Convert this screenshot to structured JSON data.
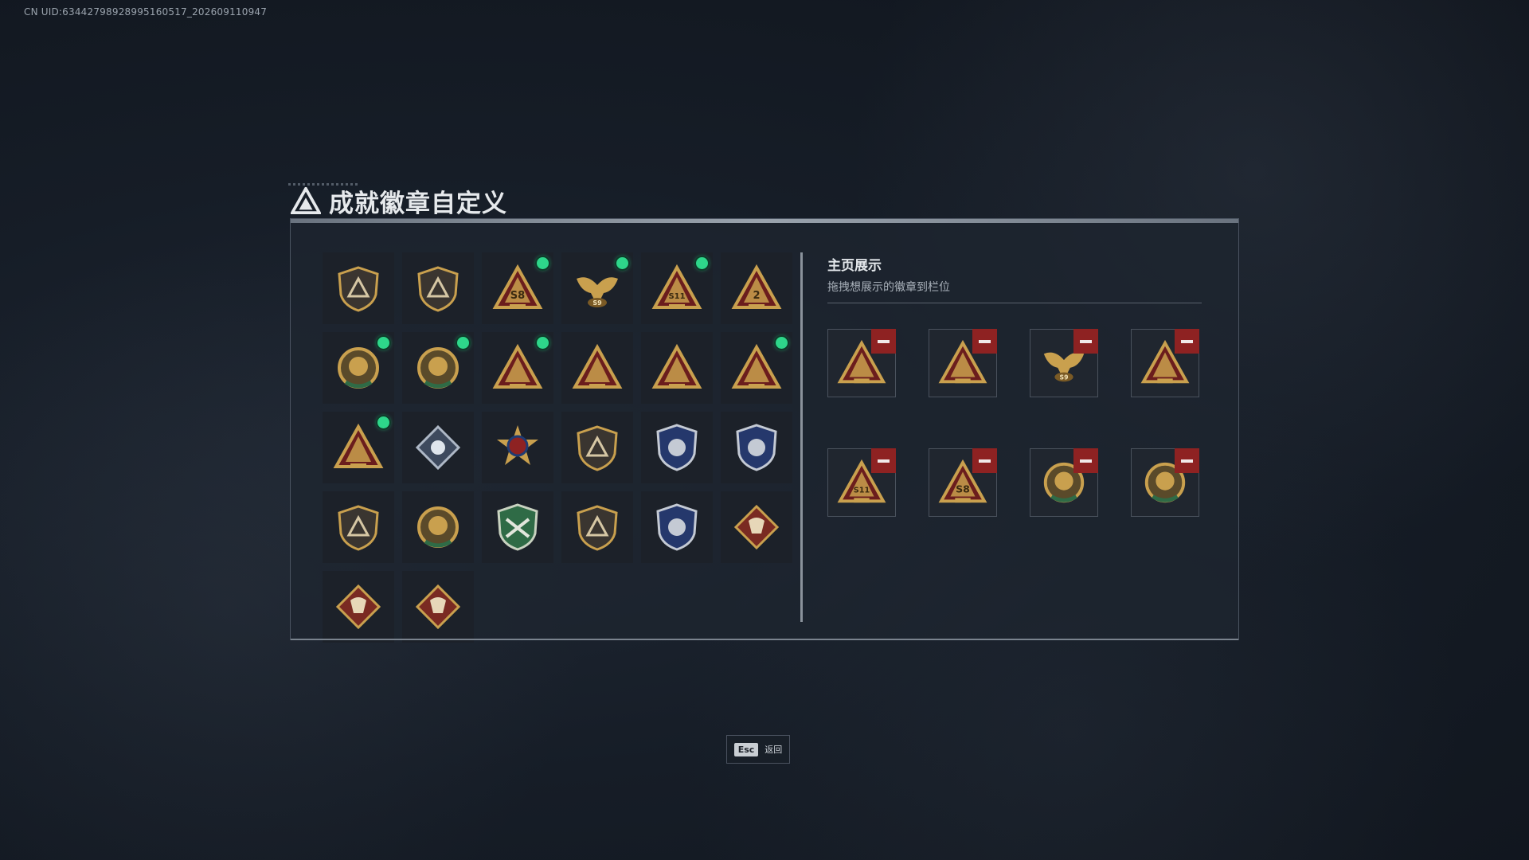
{
  "uid_text": "CN UID:63442798928995160517_202609110947",
  "title": "成就徽章自定义",
  "showcase": {
    "title": "主页展示",
    "subtitle": "拖拽想展示的徽章到栏位"
  },
  "footer": {
    "key": "Esc",
    "label": "返回"
  },
  "colors": {
    "gold": "#c9a04e",
    "red": "#8e2222",
    "blue": "#2d3f73",
    "green": "#2ed68a",
    "dark_green": "#2f6b46",
    "navy": "#25386c"
  },
  "badges": [
    {
      "icon": "shield-triangle-badge-icon",
      "shape": "shield",
      "new": false
    },
    {
      "icon": "helicopter-badge-icon",
      "shape": "shield",
      "new": false
    },
    {
      "icon": "s8-triangle-badge-icon",
      "shape": "triangle",
      "label": "S8",
      "new": true
    },
    {
      "icon": "eagle-s9-badge-icon",
      "shape": "eagle",
      "label": "S9",
      "new": true
    },
    {
      "icon": "s11-triangle-badge-icon",
      "shape": "triangle",
      "label": "S11",
      "new": true
    },
    {
      "icon": "number-2-triangle-badge-icon",
      "shape": "triangle",
      "label": "2",
      "new": false
    },
    {
      "icon": "delta-force-dragon-badge-icon",
      "shape": "round",
      "new": true
    },
    {
      "icon": "delta-force-2025-badge-icon",
      "shape": "round",
      "new": true
    },
    {
      "icon": "tower-triangle-badge-icon",
      "shape": "triangle",
      "new": true
    },
    {
      "icon": "emblem-triangle-badge-icon",
      "shape": "triangle",
      "new": false
    },
    {
      "icon": "soldiers-triangle-badge-icon",
      "shape": "triangle",
      "new": false
    },
    {
      "icon": "squad-triangle-badge-icon",
      "shape": "triangle",
      "new": true
    },
    {
      "icon": "rocket-triangle-badge-icon",
      "shape": "triangle",
      "new": true
    },
    {
      "icon": "silver-diamond-badge-icon",
      "shape": "diamond",
      "new": false
    },
    {
      "icon": "star-medal-badge-icon",
      "shape": "medal",
      "new": false
    },
    {
      "icon": "arrow-shield-badge-icon",
      "shape": "shield",
      "new": false
    },
    {
      "icon": "blue-shield-badge-icon",
      "shape": "blueshield",
      "new": false
    },
    {
      "icon": "blue-shield-stars-badge-icon",
      "shape": "blueshield",
      "new": false
    },
    {
      "icon": "eagle-shield-badge-icon",
      "shape": "shield",
      "new": false
    },
    {
      "icon": "skull-round-badge-icon",
      "shape": "round",
      "new": false
    },
    {
      "icon": "green-rifle-shield-badge-icon",
      "shape": "greenshield",
      "new": false
    },
    {
      "icon": "rifle-shield-badge-icon",
      "shape": "shield",
      "new": false
    },
    {
      "icon": "blue-rifles-shield-badge-icon",
      "shape": "blueshield",
      "new": false
    },
    {
      "icon": "red-dragon-diamond-badge-icon",
      "shape": "reddiamond",
      "new": false
    },
    {
      "icon": "red-dragon-head-badge-icon",
      "shape": "reddiamond",
      "new": false
    },
    {
      "icon": "red-soldier-diamond-badge-icon",
      "shape": "reddiamond",
      "new": false
    }
  ],
  "slots": [
    {
      "icon": "tower-triangle-badge-icon",
      "shape": "triangle"
    },
    {
      "icon": "rocket-triangle-badge-icon",
      "shape": "triangle"
    },
    {
      "icon": "eagle-s9-badge-icon",
      "shape": "eagle",
      "label": "S9"
    },
    {
      "icon": "squad-triangle-badge-icon",
      "shape": "triangle"
    },
    {
      "icon": "s11-triangle-badge-icon",
      "shape": "triangle",
      "label": "S11"
    },
    {
      "icon": "s8-triangle-badge-icon",
      "shape": "triangle",
      "label": "S8"
    },
    {
      "icon": "delta-force-dragon-badge-icon",
      "shape": "round"
    },
    {
      "icon": "delta-force-2025-badge-icon",
      "shape": "round"
    }
  ]
}
